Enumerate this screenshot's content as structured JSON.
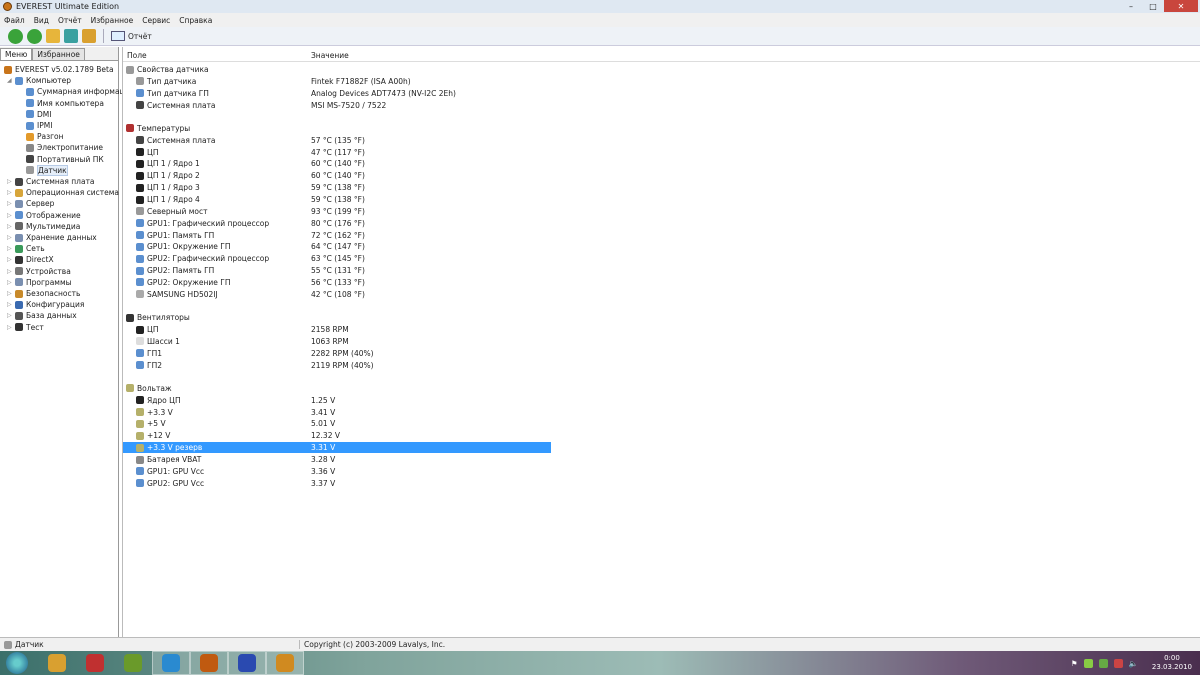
{
  "window": {
    "title": "EVEREST Ultimate Edition"
  },
  "menu": [
    "Файл",
    "Вид",
    "Отчёт",
    "Избранное",
    "Сервис",
    "Справка"
  ],
  "toolbar": {
    "report_label": "Отчёт"
  },
  "left": {
    "tabs": [
      "Меню",
      "Избранное"
    ],
    "tree": [
      {
        "label": "EVEREST v5.02.1789 Beta",
        "level": 0,
        "icon": "everest-icon",
        "color": "#c8741a"
      },
      {
        "label": "Компьютер",
        "level": 1,
        "icon": "computer-icon",
        "color": "#5b8fcf",
        "expanded": true
      },
      {
        "label": "Суммарная информация",
        "level": 2,
        "icon": "computer-icon",
        "color": "#5b8fcf"
      },
      {
        "label": "Имя компьютера",
        "level": 2,
        "icon": "computer-icon",
        "color": "#5b8fcf"
      },
      {
        "label": "DMI",
        "level": 2,
        "icon": "computer-icon",
        "color": "#5b8fcf"
      },
      {
        "label": "IPMI",
        "level": 2,
        "icon": "computer-icon",
        "color": "#5b8fcf"
      },
      {
        "label": "Разгон",
        "level": 2,
        "icon": "overclock-icon",
        "color": "#e39a2b"
      },
      {
        "label": "Электропитание",
        "level": 2,
        "icon": "power-icon",
        "color": "#888"
      },
      {
        "label": "Портативный ПК",
        "level": 2,
        "icon": "laptop-icon",
        "color": "#444"
      },
      {
        "label": "Датчик",
        "level": 2,
        "icon": "sensor-icon",
        "color": "#999",
        "selected": true
      },
      {
        "label": "Системная плата",
        "level": 1,
        "icon": "motherboard-icon",
        "color": "#444"
      },
      {
        "label": "Операционная система",
        "level": 1,
        "icon": "os-icon",
        "color": "#d7a53a"
      },
      {
        "label": "Сервер",
        "level": 1,
        "icon": "server-icon",
        "color": "#7a8fb0"
      },
      {
        "label": "Отображение",
        "level": 1,
        "icon": "display-icon",
        "color": "#5b8fcf"
      },
      {
        "label": "Мультимедиа",
        "level": 1,
        "icon": "multimedia-icon",
        "color": "#666"
      },
      {
        "label": "Хранение данных",
        "level": 1,
        "icon": "storage-icon",
        "color": "#7a8fb0"
      },
      {
        "label": "Сеть",
        "level": 1,
        "icon": "network-icon",
        "color": "#3a9a5a"
      },
      {
        "label": "DirectX",
        "level": 1,
        "icon": "directx-icon",
        "color": "#333"
      },
      {
        "label": "Устройства",
        "level": 1,
        "icon": "devices-icon",
        "color": "#777"
      },
      {
        "label": "Программы",
        "level": 1,
        "icon": "programs-icon",
        "color": "#7a8fb0"
      },
      {
        "label": "Безопасность",
        "level": 1,
        "icon": "security-icon",
        "color": "#c88a2a"
      },
      {
        "label": "Конфигурация",
        "level": 1,
        "icon": "config-icon",
        "color": "#3a6ab0"
      },
      {
        "label": "База данных",
        "level": 1,
        "icon": "database-icon",
        "color": "#555"
      },
      {
        "label": "Тест",
        "level": 1,
        "icon": "hourglass-icon",
        "color": "#333"
      }
    ]
  },
  "table": {
    "headers": [
      "Поле",
      "Значение"
    ],
    "groups": [
      {
        "title": "Свойства датчика",
        "icon": "sensor-icon",
        "color": "#999",
        "rows": [
          {
            "field": "Тип датчика",
            "value": "Fintek F71882F  (ISA A00h)",
            "icon": "sensor-icon",
            "color": "#999"
          },
          {
            "field": "Тип датчика ГП",
            "value": "Analog Devices ADT7473  (NV-I2C 2Eh)",
            "icon": "gpu-icon",
            "color": "#5b8fcf"
          },
          {
            "field": "Системная плата",
            "value": "MSI MS-7520 / 7522",
            "icon": "motherboard-icon",
            "color": "#444"
          }
        ]
      },
      {
        "title": "Температуры",
        "icon": "thermometer-icon",
        "color": "#b03030",
        "rows": [
          {
            "field": "Системная плата",
            "value": "57 °C  (135 °F)",
            "icon": "motherboard-icon",
            "color": "#444"
          },
          {
            "field": "ЦП",
            "value": "47 °C  (117 °F)",
            "icon": "cpu-icon",
            "color": "#222"
          },
          {
            "field": "ЦП 1 / Ядро 1",
            "value": "60 °C  (140 °F)",
            "icon": "cpu-icon",
            "color": "#222"
          },
          {
            "field": "ЦП 1 / Ядро 2",
            "value": "60 °C  (140 °F)",
            "icon": "cpu-icon",
            "color": "#222"
          },
          {
            "field": "ЦП 1 / Ядро 3",
            "value": "59 °C  (138 °F)",
            "icon": "cpu-icon",
            "color": "#222"
          },
          {
            "field": "ЦП 1 / Ядро 4",
            "value": "59 °C  (138 °F)",
            "icon": "cpu-icon",
            "color": "#222"
          },
          {
            "field": "Северный мост",
            "value": "93 °C  (199 °F)",
            "icon": "chipset-icon",
            "color": "#999"
          },
          {
            "field": "GPU1: Графический процессор",
            "value": "80 °C  (176 °F)",
            "icon": "gpu-icon",
            "color": "#5b8fcf"
          },
          {
            "field": "GPU1: Память ГП",
            "value": "72 °C  (162 °F)",
            "icon": "gpu-icon",
            "color": "#5b8fcf"
          },
          {
            "field": "GPU1: Окружение ГП",
            "value": "64 °C  (147 °F)",
            "icon": "gpu-icon",
            "color": "#5b8fcf"
          },
          {
            "field": "GPU2: Графический процессор",
            "value": "63 °C  (145 °F)",
            "icon": "gpu-icon",
            "color": "#5b8fcf"
          },
          {
            "field": "GPU2: Память ГП",
            "value": "55 °C  (131 °F)",
            "icon": "gpu-icon",
            "color": "#5b8fcf"
          },
          {
            "field": "GPU2: Окружение ГП",
            "value": "56 °C  (133 °F)",
            "icon": "gpu-icon",
            "color": "#5b8fcf"
          },
          {
            "field": "SAMSUNG HD502IJ",
            "value": "42 °C  (108 °F)",
            "icon": "hdd-icon",
            "color": "#aaa"
          }
        ]
      },
      {
        "title": "Вентиляторы",
        "icon": "fan-icon",
        "color": "#333",
        "rows": [
          {
            "field": "ЦП",
            "value": "2158 RPM",
            "icon": "cpu-icon",
            "color": "#222"
          },
          {
            "field": "Шасси 1",
            "value": "1063 RPM",
            "icon": "chassis-icon",
            "color": "#ddd"
          },
          {
            "field": "ГП1",
            "value": "2282 RPM  (40%)",
            "icon": "gpu-icon",
            "color": "#5b8fcf"
          },
          {
            "field": "ГП2",
            "value": "2119 RPM  (40%)",
            "icon": "gpu-icon",
            "color": "#5b8fcf"
          }
        ]
      },
      {
        "title": "Вольтаж",
        "icon": "voltage-icon",
        "color": "#b5b06a",
        "rows": [
          {
            "field": "Ядро ЦП",
            "value": "1.25 V",
            "icon": "cpu-icon",
            "color": "#222"
          },
          {
            "field": "+3.3 V",
            "value": "3.41 V",
            "icon": "voltage-icon",
            "color": "#b5b06a"
          },
          {
            "field": "+5 V",
            "value": "5.01 V",
            "icon": "voltage-icon",
            "color": "#b5b06a"
          },
          {
            "field": "+12 V",
            "value": "12.32 V",
            "icon": "voltage-icon",
            "color": "#b5b06a"
          },
          {
            "field": "+3.3 V резерв",
            "value": "3.31 V",
            "icon": "voltage-icon",
            "color": "#b5b06a",
            "selected": true
          },
          {
            "field": "Батарея VBAT",
            "value": "3.28 V",
            "icon": "battery-icon",
            "color": "#888"
          },
          {
            "field": "GPU1: GPU Vcc",
            "value": "3.36 V",
            "icon": "gpu-icon",
            "color": "#5b8fcf"
          },
          {
            "field": "GPU2: GPU Vcc",
            "value": "3.37 V",
            "icon": "gpu-icon",
            "color": "#5b8fcf"
          }
        ]
      }
    ]
  },
  "status": {
    "left": "Датчик",
    "copyright": "Copyright (c) 2003-2009 Lavalys, Inc."
  },
  "taskbar": {
    "apps": [
      {
        "name": "winamp",
        "color": "#d9a030"
      },
      {
        "name": "foxit",
        "color": "#c03030"
      },
      {
        "name": "everest-green",
        "color": "#6a9a2a"
      },
      {
        "name": "media-player",
        "color": "#2a8ad0"
      },
      {
        "name": "app-orange",
        "color": "#c05a10"
      },
      {
        "name": "save-app",
        "color": "#2a4ab0"
      },
      {
        "name": "everest",
        "color": "#d08a20"
      }
    ],
    "time": "0:00",
    "date": "23.03.2010"
  }
}
